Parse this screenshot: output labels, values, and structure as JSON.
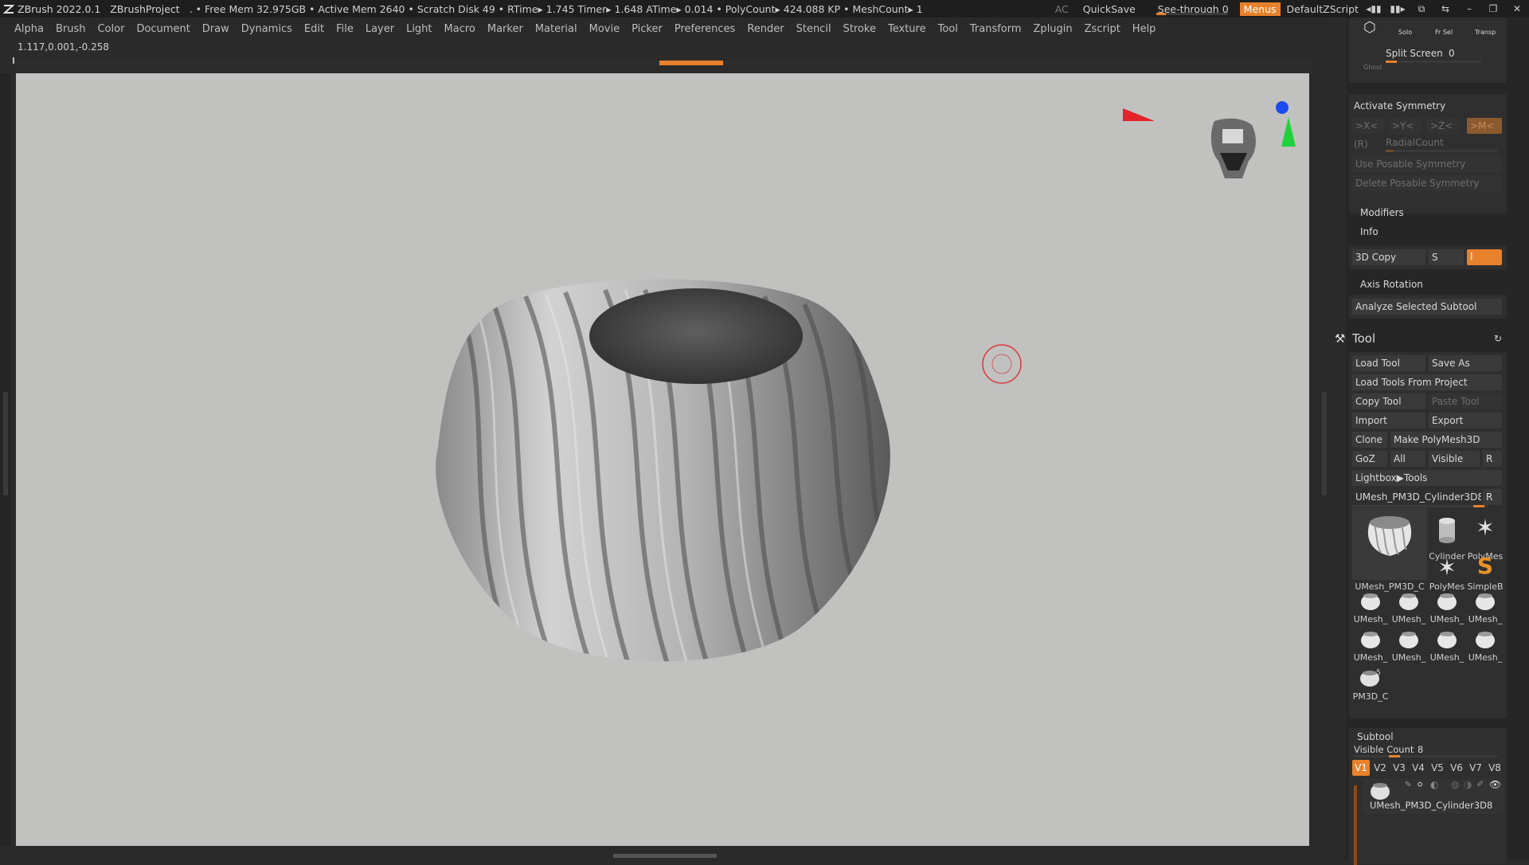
{
  "titlebar": {
    "app": "ZBrush 2022.0.1",
    "project": "ZBrushProject",
    "stats": ". • Free Mem 32.975GB • Active Mem 2640 • Scratch Disk 49 • RTime▸ 1.745 Timer▸ 1.648 ATime▸ 0.014 • PolyCount▸ 424.088 KP • MeshCount▸ 1",
    "ac": "AC",
    "quicksave": "QuickSave",
    "seethrough": "See-through  0",
    "menus": "Menus",
    "script": "DefaultZScript"
  },
  "menubar": [
    "Alpha",
    "Brush",
    "Color",
    "Document",
    "Draw",
    "Dynamics",
    "Edit",
    "File",
    "Layer",
    "Light",
    "Macro",
    "Marker",
    "Material",
    "Movie",
    "Picker",
    "Preferences",
    "Render",
    "Stencil",
    "Stroke",
    "Texture",
    "Tool",
    "Transform",
    "Zplugin",
    "Zscript",
    "Help"
  ],
  "coords": "1.117,0.001,-0.258",
  "panel": {
    "top_icons": {
      "solo": "Solo",
      "frsel": "Fr Sel",
      "transp": "Transp",
      "ghost": "Ghost"
    },
    "split_screen": "Split Screen",
    "split_screen_value": "0",
    "symmetry": {
      "activate": "Activate Symmetry",
      "x": ">X<",
      "y": ">Y<",
      "z": ">Z<",
      "m": ">M<",
      "r": "(R)",
      "radial": "RadialCount",
      "use_posable": "Use Posable Symmetry",
      "delete_posable": "Delete Posable Symmetry"
    },
    "modifiers": "Modifiers",
    "info": "Info",
    "copy3d": "3D Copy",
    "s": "S",
    "field_value": "I",
    "axis_rotation": "Axis Rotation",
    "analyze": "Analyze Selected Subtool",
    "tool_title": "Tool",
    "load_tool": "Load Tool",
    "save_as": "Save As",
    "load_from_project": "Load Tools From Project",
    "copy_tool": "Copy Tool",
    "paste_tool": "Paste Tool",
    "import": "Import",
    "export": "Export",
    "clone": "Clone",
    "make_polymesh": "Make PolyMesh3D",
    "goz": "GoZ",
    "all": "All",
    "visible": "Visible",
    "r": "R",
    "lightbox": "Lightbox▶Tools",
    "current_tool": "UMesh_PM3D_Cylinder3D8.",
    "thumbs": {
      "main": "UMesh_PM3D_C",
      "cylinder": "Cylinder",
      "polymes1": "PolyMes",
      "polymes2": "PolyMes",
      "simpleb": "SimpleB",
      "row1": [
        "UMesh_",
        "UMesh_",
        "UMesh_",
        "UMesh_"
      ],
      "row2": [
        "UMesh_",
        "UMesh_",
        "UMesh_",
        "UMesh_"
      ],
      "last": "PM3D_C",
      "last_badge": "5"
    },
    "subtool": "Subtool",
    "visible_count": "Visible Count",
    "visible_count_value": "8",
    "vtabs": [
      "V1",
      "V2",
      "V3",
      "V4",
      "V5",
      "V6",
      "V7",
      "V8"
    ],
    "subtool_name": "UMesh_PM3D_Cylinder3D8"
  },
  "colors": {
    "accent": "#e8812b",
    "viewport": "#c1c1c0"
  }
}
